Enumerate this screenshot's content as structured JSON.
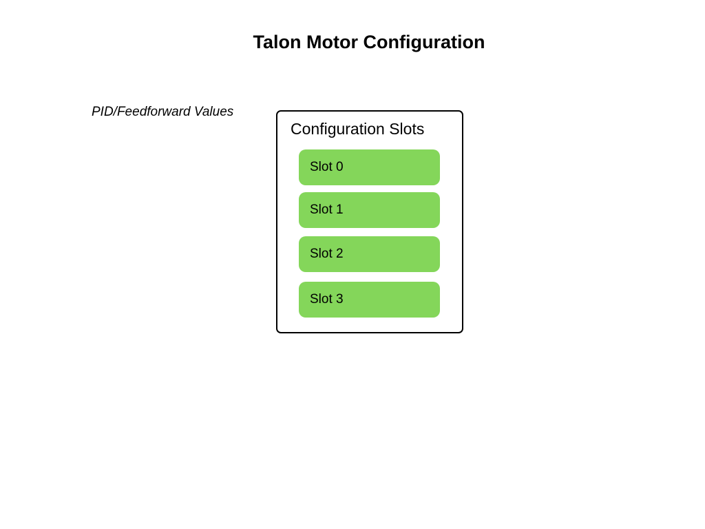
{
  "page": {
    "title": "Talon Motor Configuration"
  },
  "side_label": "PID/Feedforward Values",
  "config_box": {
    "title": "Configuration Slots",
    "slots": [
      {
        "label": "Slot 0"
      },
      {
        "label": "Slot 1"
      },
      {
        "label": "Slot 2"
      },
      {
        "label": "Slot 3"
      }
    ]
  },
  "colors": {
    "slot_fill": "#84d65a",
    "box_border": "#000000",
    "background": "#ffffff"
  }
}
